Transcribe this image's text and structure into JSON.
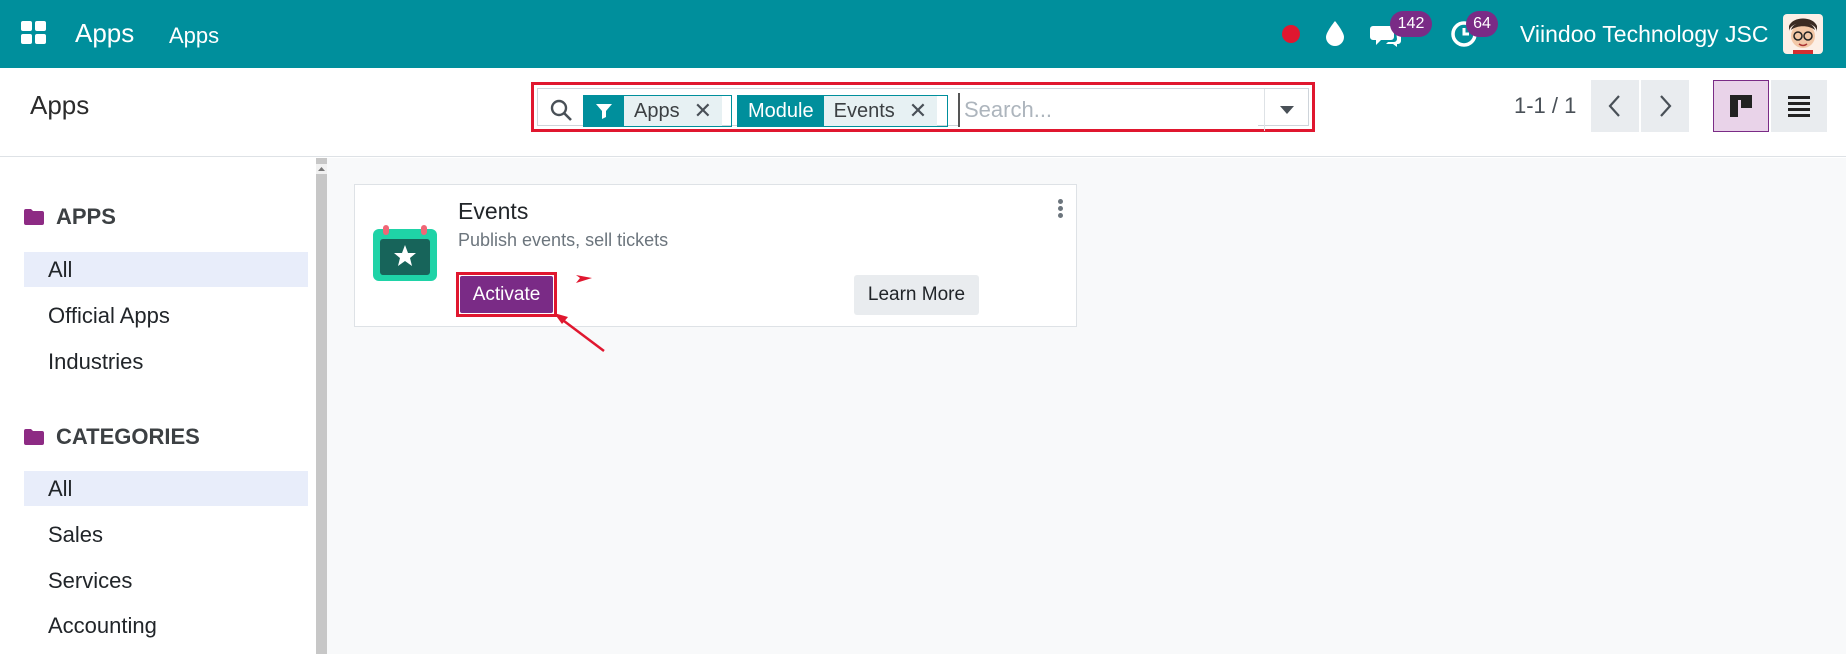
{
  "navbar": {
    "brand": "Apps",
    "menu_item": "Apps",
    "messages_count": "142",
    "activities_count": "64",
    "company": "Viindoo Technology JSC",
    "color": "#008f9c"
  },
  "control_panel": {
    "title": "Apps",
    "facets": [
      {
        "label": "",
        "label_icon": "filter-icon",
        "value": "Apps"
      },
      {
        "label": "Module",
        "value": "Events"
      }
    ],
    "search_placeholder": "Search...",
    "pager": "1-1 / 1"
  },
  "sidebar": {
    "sections": [
      {
        "title": "APPS",
        "items": [
          "All",
          "Official Apps",
          "Industries"
        ],
        "active": "All"
      },
      {
        "title": "CATEGORIES",
        "items": [
          "All",
          "Sales",
          "Services",
          "Accounting"
        ],
        "active": "All"
      }
    ]
  },
  "card": {
    "title": "Events",
    "description": "Publish events, sell tickets",
    "activate_label": "Activate",
    "learn_more_label": "Learn More",
    "accent": "#7a2b86",
    "highlight": "#e0172f"
  }
}
